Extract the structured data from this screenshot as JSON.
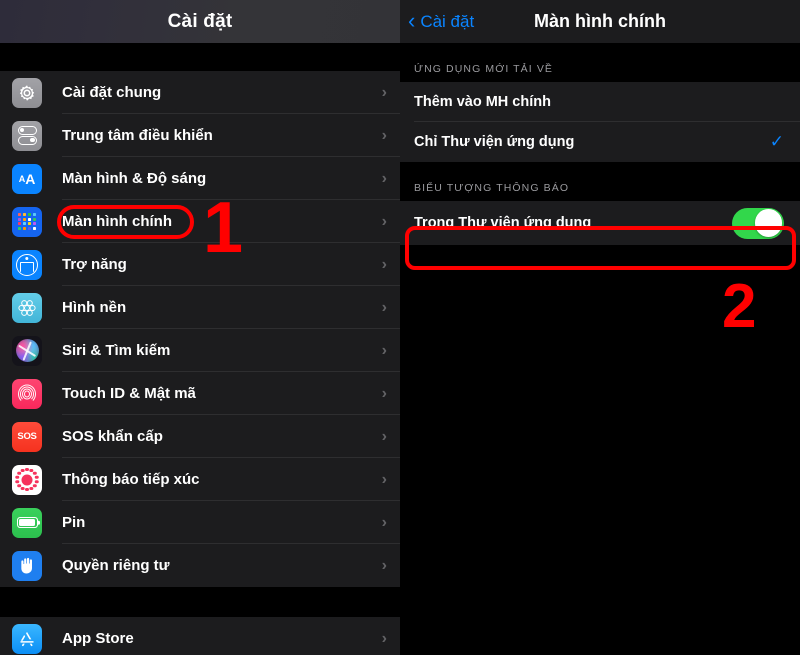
{
  "left": {
    "header_title": "Cài đặt",
    "items": [
      {
        "label": "Cài đặt chung",
        "icon": "gear-icon"
      },
      {
        "label": "Trung tâm điều khiển",
        "icon": "control-center-icon"
      },
      {
        "label": "Màn hình & Độ sáng",
        "icon": "display-brightness-icon"
      },
      {
        "label": "Màn hình chính",
        "icon": "home-screen-icon",
        "highlighted": true
      },
      {
        "label": "Trợ năng",
        "icon": "accessibility-icon"
      },
      {
        "label": "Hình nền",
        "icon": "wallpaper-icon"
      },
      {
        "label": "Siri & Tìm kiếm",
        "icon": "siri-icon"
      },
      {
        "label": "Touch ID & Mật mã",
        "icon": "touch-id-icon"
      },
      {
        "label": "SOS khẩn cấp",
        "icon": "sos-icon"
      },
      {
        "label": "Thông báo tiếp xúc",
        "icon": "exposure-notification-icon"
      },
      {
        "label": "Pin",
        "icon": "battery-icon"
      },
      {
        "label": "Quyền riêng tư",
        "icon": "privacy-hand-icon"
      }
    ],
    "items_group2": [
      {
        "label": "App Store",
        "icon": "app-store-icon"
      }
    ]
  },
  "right": {
    "back_label": "Cài đặt",
    "title": "Màn hình chính",
    "section1": {
      "header": "ỨNG DỤNG MỚI TẢI VỀ",
      "rows": [
        {
          "label": "Thêm vào MH chính",
          "checked": false
        },
        {
          "label": "Chỉ Thư viện ứng dụng",
          "checked": true,
          "check_glyph": "✓"
        }
      ]
    },
    "section2": {
      "header": "BIỂU TƯỢNG THÔNG BÁO",
      "rows": [
        {
          "label": "Trong Thư viện ứng dụng",
          "toggle_on": true
        }
      ]
    }
  },
  "annotations": {
    "step1": "1",
    "step2": "2"
  },
  "colors": {
    "accent_blue": "#0a84ff",
    "toggle_green": "#32d74b",
    "annotation_red": "#ff0000",
    "group_bg": "#1c1c1e",
    "page_bg": "#000000"
  },
  "icon_colors": {
    "home_grid": [
      "#ff5f57",
      "#ffbd2e",
      "#28c840",
      "#5ac8fa",
      "#af52de",
      "#ff9f0a",
      "#ffffff",
      "#34c759",
      "#ff375f",
      "#64d2ff",
      "#ffd60a",
      "#bf5af2",
      "#30d158",
      "#ff9500",
      "#5e5ce6",
      "#ffffff"
    ]
  }
}
